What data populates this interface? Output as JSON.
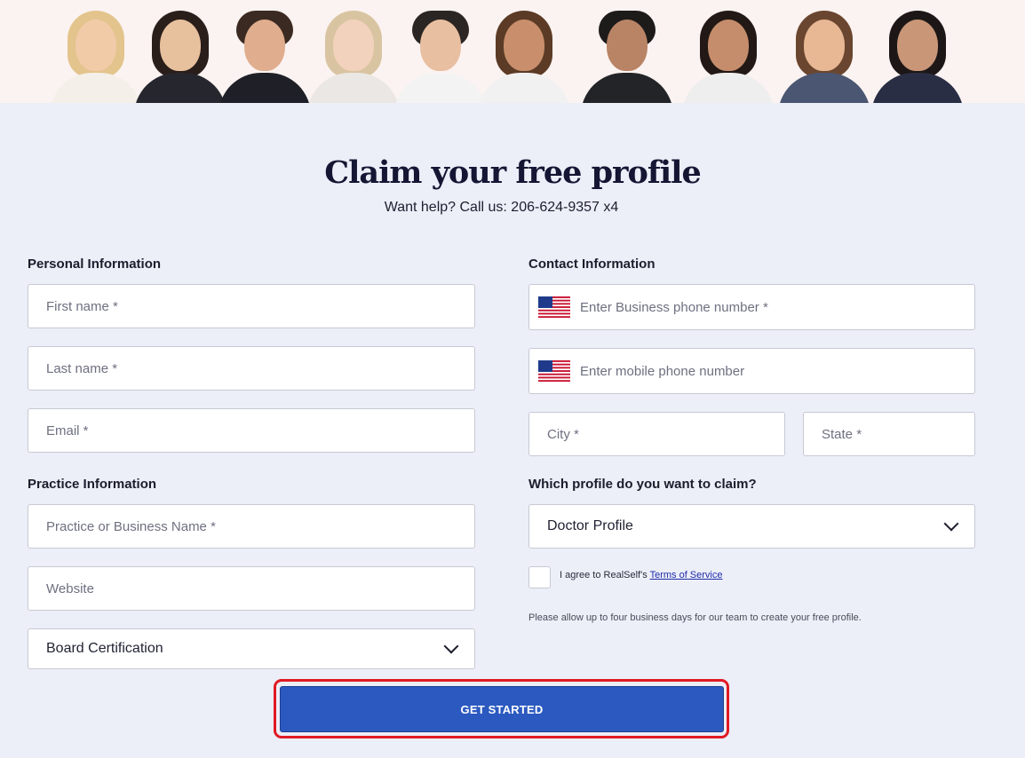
{
  "header": {
    "title": "Claim your free profile",
    "help_text": "Want help? Call us: 206-624-9357 x4"
  },
  "personal": {
    "label": "Personal Information",
    "first_name_placeholder": "First name *",
    "last_name_placeholder": "Last name *",
    "email_placeholder": "Email *"
  },
  "practice": {
    "label": "Practice Information",
    "business_placeholder": "Practice or Business Name *",
    "website_placeholder": "Website",
    "board_cert_value": "Board Certification"
  },
  "contact": {
    "label": "Contact Information",
    "business_phone_placeholder": "Enter Business phone number *",
    "mobile_phone_placeholder": "Enter mobile phone number",
    "city_placeholder": "City *",
    "state_placeholder": "State *"
  },
  "profile": {
    "label": "Which profile do you want to claim?",
    "selected": "Doctor Profile"
  },
  "terms": {
    "prefix": "I agree to RealSelf's ",
    "link": "Terms of Service"
  },
  "note": "Please allow up to four business days for our team to create your free profile.",
  "cta_label": "GET STARTED",
  "colors": {
    "accent": "#2b59c0",
    "highlight": "#e01a24",
    "background": "#eceef8",
    "banner": "#fbf3f1"
  }
}
